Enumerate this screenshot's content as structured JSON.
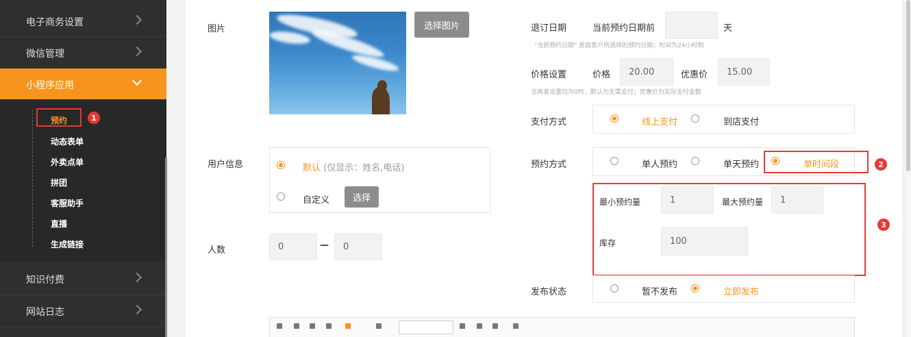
{
  "sidebar": {
    "items": [
      {
        "label": "电子商务设置"
      },
      {
        "label": "微信管理"
      },
      {
        "label": "小程序应用"
      },
      {
        "label": "知识付费"
      },
      {
        "label": "网站日志"
      }
    ],
    "sub_items": [
      {
        "label": "预约"
      },
      {
        "label": "动态表单"
      },
      {
        "label": "外卖点单"
      },
      {
        "label": "拼团"
      },
      {
        "label": "客服助手"
      },
      {
        "label": "直播"
      },
      {
        "label": "生成链接"
      }
    ]
  },
  "form": {
    "image_label": "图片",
    "select_image_button": "选择图片",
    "user_info_label": "用户信息",
    "user_info_default": "默认",
    "user_info_default_note": "(仅显示：姓名,电话)",
    "user_info_custom": "自定义",
    "select_button": "选择",
    "people_label": "人数",
    "people_min": "0",
    "people_max": "0",
    "people_sep": "—",
    "cancel_date_label": "退订日期",
    "cancel_date_prefix": "当前预约日期前",
    "cancel_date_unit": "天",
    "cancel_date_hint": "\"当前预约日期\" 是指客户所选择的预约日期；时间为24小时制",
    "price_label": "价格设置",
    "price_field_label": "价格",
    "price_value": "20.00",
    "discount_field_label": "优惠价",
    "discount_value": "15.00",
    "price_hint": "当两者设置均为0时，默认为无需支付；优惠价为实际支付金额",
    "payment_label": "支付方式",
    "payment_online": "线上支付",
    "payment_store": "到店支付",
    "booking_label": "预约方式",
    "booking_single": "单人预约",
    "booking_day": "单天预约",
    "booking_slot": "单时间段",
    "min_booking_label": "最小预约量",
    "min_booking_value": "1",
    "max_booking_label": "最大预约量",
    "max_booking_value": "1",
    "stock_label": "库存",
    "stock_value": "100",
    "publish_label": "发布状态",
    "publish_no": "暂不发布",
    "publish_now": "立即发布"
  },
  "annotations": {
    "badge1": "1",
    "badge2": "2",
    "badge3": "3"
  },
  "colors": {
    "accent": "#f7941d",
    "annotation_red": "#e53935",
    "sidebar_bg": "#2f2f2f"
  }
}
